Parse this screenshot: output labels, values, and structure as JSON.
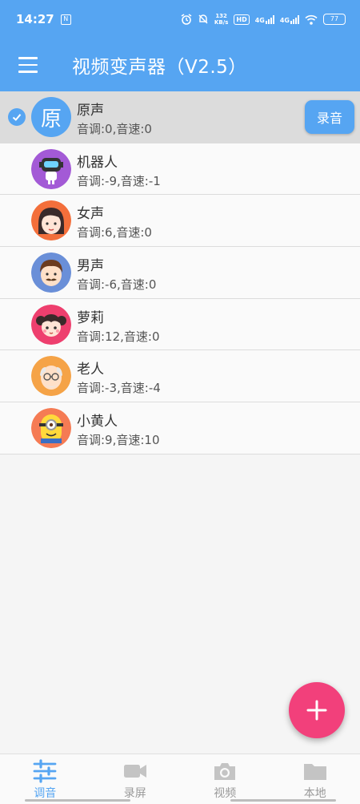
{
  "status_bar": {
    "time": "14:27",
    "net_speed_value": "132",
    "net_speed_unit": "KB/s",
    "hd_label": "HD",
    "sim1_label": "4G",
    "sim2_label": "4G",
    "battery": "77"
  },
  "app_bar": {
    "title": "视频变声器（V2.5）"
  },
  "voices": [
    {
      "name": "原声",
      "params": "音调:0,音速:0",
      "avatar_char": "原",
      "selected": true
    },
    {
      "name": "机器人",
      "params": "音调:-9,音速:-1",
      "avatar": "robot-avatar"
    },
    {
      "name": "女声",
      "params": "音调:6,音速:0",
      "avatar": "woman-avatar"
    },
    {
      "name": "男声",
      "params": "音调:-6,音速:0",
      "avatar": "man-avatar"
    },
    {
      "name": "萝莉",
      "params": "音调:12,音速:0",
      "avatar": "girl-avatar"
    },
    {
      "name": "老人",
      "params": "音调:-3,音速:-4",
      "avatar": "old-man-avatar"
    },
    {
      "name": "小黄人",
      "params": "音调:9,音速:10",
      "avatar": "minion-avatar"
    }
  ],
  "record_button": "录音",
  "bottom_nav": [
    {
      "label": "调音",
      "icon": "tune-icon",
      "active": true
    },
    {
      "label": "录屏",
      "icon": "video-camera-icon"
    },
    {
      "label": "视频",
      "icon": "camera-icon"
    },
    {
      "label": "本地",
      "icon": "folder-icon"
    }
  ],
  "colors": {
    "primary": "#56a5f2",
    "fab": "#f2407b",
    "selected_row": "#dcdcdc"
  }
}
